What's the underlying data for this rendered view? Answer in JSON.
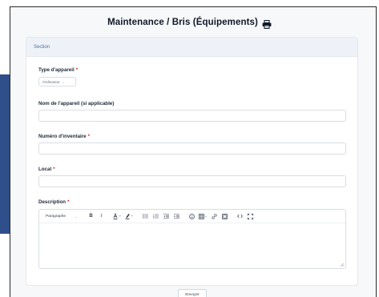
{
  "form": {
    "title": "Maintenance / Bris (Équipements)",
    "print_icon": "printer-icon",
    "section_label": "Section",
    "required_marker": "*",
    "fields": {
      "device_type": {
        "label": "Type d'appareil",
        "required": true,
        "value": "Ordinateur"
      },
      "device_name": {
        "label": "Nom de l'appareil (si applicable)",
        "required": false,
        "value": ""
      },
      "inventory_number": {
        "label": "Numéro d'inventaire",
        "required": true,
        "value": ""
      },
      "room": {
        "label": "Local",
        "required": true,
        "value": ""
      },
      "description": {
        "label": "Description",
        "required": true,
        "value": ""
      }
    },
    "editor_toolbar": {
      "paragraph_label": "Paragraphe",
      "bold_label": "B",
      "italic_label": "I",
      "icons": [
        "bold-icon",
        "italic-icon",
        "text-color-icon",
        "highlight-icon",
        "bulleted-list-icon",
        "numbered-list-icon",
        "outdent-icon",
        "indent-icon",
        "emoji-icon",
        "table-icon",
        "link-icon",
        "image-icon",
        "source-code-icon",
        "fullscreen-icon"
      ]
    },
    "submit_label": "Envoyer"
  }
}
